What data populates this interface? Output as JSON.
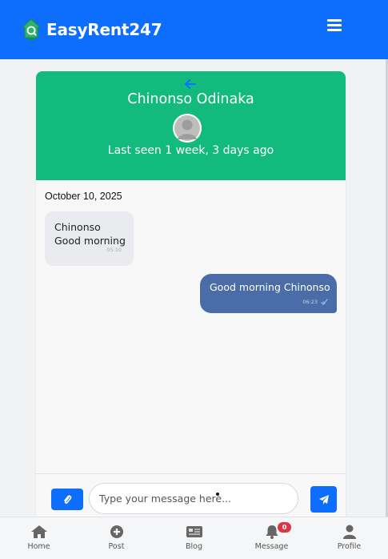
{
  "brand": {
    "name": "EasyRent247",
    "logo_icon": "house-search-icon"
  },
  "header": {
    "menu_icon": "hamburger-icon"
  },
  "chat": {
    "back_icon": "arrow-left-icon",
    "contact_name": "Chinonso Odinaka",
    "avatar_icon": "user-avatar-placeholder",
    "last_seen": "Last seen 1 week, 3 days ago",
    "date": "October 10, 2025",
    "messages": [
      {
        "direction": "incoming",
        "lines": [
          "Chinonso",
          "Good morning"
        ],
        "time": "05:10"
      },
      {
        "direction": "outgoing",
        "text": "Good morning Chinonso",
        "time": "06:23",
        "status_icon": "double-check-icon"
      }
    ],
    "composer": {
      "attach_icon": "paperclip-icon",
      "placeholder": "Type your message here...",
      "value": "",
      "send_icon": "paper-plane-icon"
    }
  },
  "bottom_nav": {
    "items": [
      {
        "label": "Home",
        "icon": "home-icon"
      },
      {
        "label": "Post",
        "icon": "plus-circle-icon"
      },
      {
        "label": "Blog",
        "icon": "newspaper-icon"
      },
      {
        "label": "Message",
        "icon": "bell-icon",
        "badge": "0"
      },
      {
        "label": "Profile",
        "icon": "user-icon"
      }
    ]
  },
  "colors": {
    "primary": "#0d6efd",
    "chat_header": "#12bb7d",
    "outgoing_bubble": "#4a6da7",
    "incoming_bubble": "#e9ebee",
    "badge": "#dc3545"
  }
}
